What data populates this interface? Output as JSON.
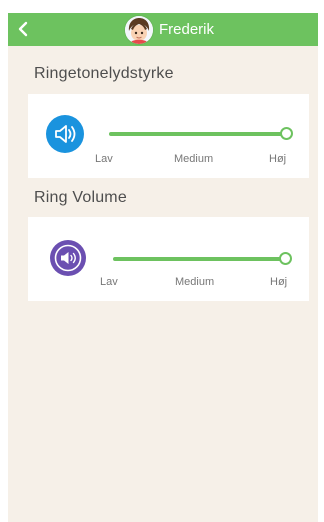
{
  "header": {
    "title": "Frederik",
    "background_color": "#6dc25f",
    "back_icon": "chevron-left-icon",
    "avatar_icon": "child-avatar"
  },
  "sections": [
    {
      "label": "Ringetonelydstyrke",
      "icon": "speaker-icon",
      "icon_color": "#1a93de",
      "level": 1.0,
      "scale_labels": {
        "low": "Lav",
        "mid": "Medium",
        "high": "Høj"
      }
    },
    {
      "label": "Ring Volume",
      "icon": "speaker-icon",
      "icon_color": "#6b4fb1",
      "level": 1.0,
      "scale_labels": {
        "low": "Lav",
        "mid": "Medium",
        "high": "Høj"
      }
    }
  ],
  "colors": {
    "accent": "#6dc25f",
    "page_background": "#f6f0e8"
  }
}
